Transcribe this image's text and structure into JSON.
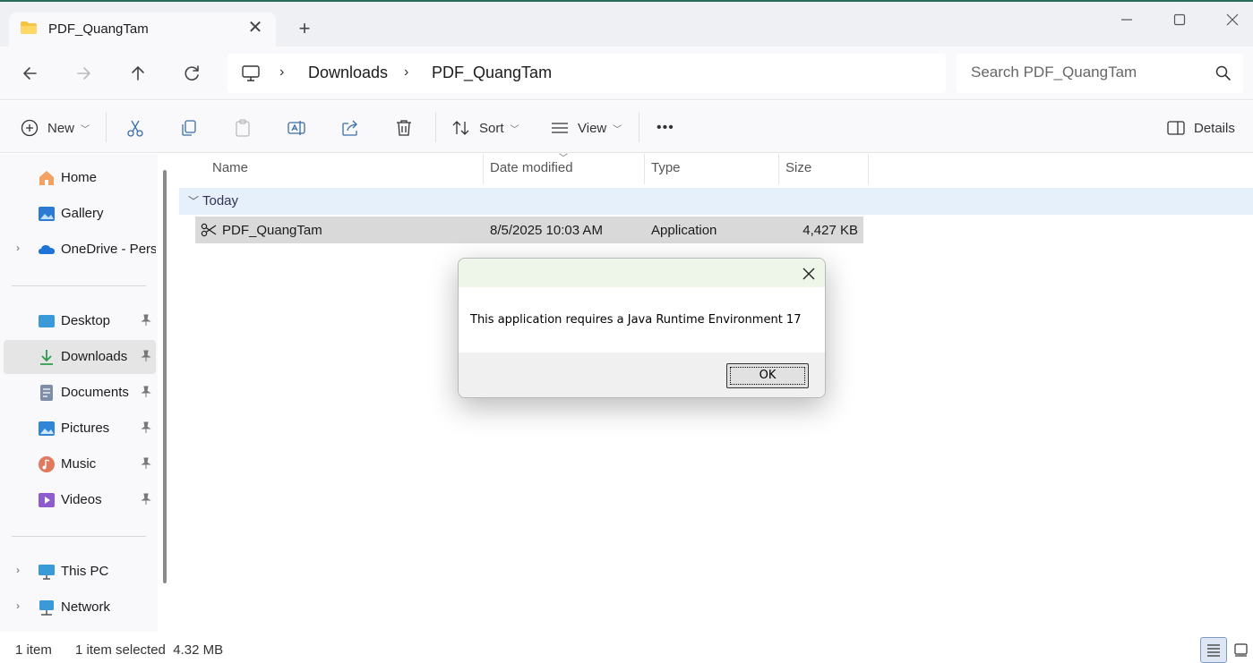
{
  "window": {
    "tab_title": "PDF_QuangTam",
    "new_tab_symbol": "+"
  },
  "address": {
    "crumbs": [
      "Downloads",
      "PDF_QuangTam"
    ],
    "search_placeholder": "Search PDF_QuangTam"
  },
  "command_bar": {
    "new_label": "New",
    "sort_label": "Sort",
    "view_label": "View",
    "more_label": "•••",
    "details_label": "Details"
  },
  "sidebar": {
    "items": [
      {
        "label": "Home",
        "icon": "home-icon"
      },
      {
        "label": "Gallery",
        "icon": "gallery-icon"
      },
      {
        "label": "OneDrive - Personal",
        "icon": "onedrive-icon"
      },
      {
        "label": "Desktop",
        "icon": "desktop-icon"
      },
      {
        "label": "Downloads",
        "icon": "downloads-icon"
      },
      {
        "label": "Documents",
        "icon": "documents-icon"
      },
      {
        "label": "Pictures",
        "icon": "pictures-icon"
      },
      {
        "label": "Music",
        "icon": "music-icon"
      },
      {
        "label": "Videos",
        "icon": "videos-icon"
      },
      {
        "label": "This PC",
        "icon": "this-pc-icon"
      },
      {
        "label": "Network",
        "icon": "network-icon"
      }
    ]
  },
  "filelist": {
    "columns": [
      "Name",
      "Date modified",
      "Type",
      "Size"
    ],
    "group_label": "Today",
    "rows": [
      {
        "name": "PDF_QuangTam",
        "date": "8/5/2025 10:03 AM",
        "type": "Application",
        "size": "4,427 KB"
      }
    ]
  },
  "status": {
    "count": "1 item",
    "selection": "1 item selected  4.32 MB"
  },
  "dialog": {
    "message": "This application requires a Java Runtime Environment 17",
    "ok_label": "OK"
  },
  "colors": {
    "selection_row": "#d9d9d9",
    "group_header": "#e6f0fa",
    "dialog_title": "#eef5e9",
    "accent": "#0067c0"
  }
}
